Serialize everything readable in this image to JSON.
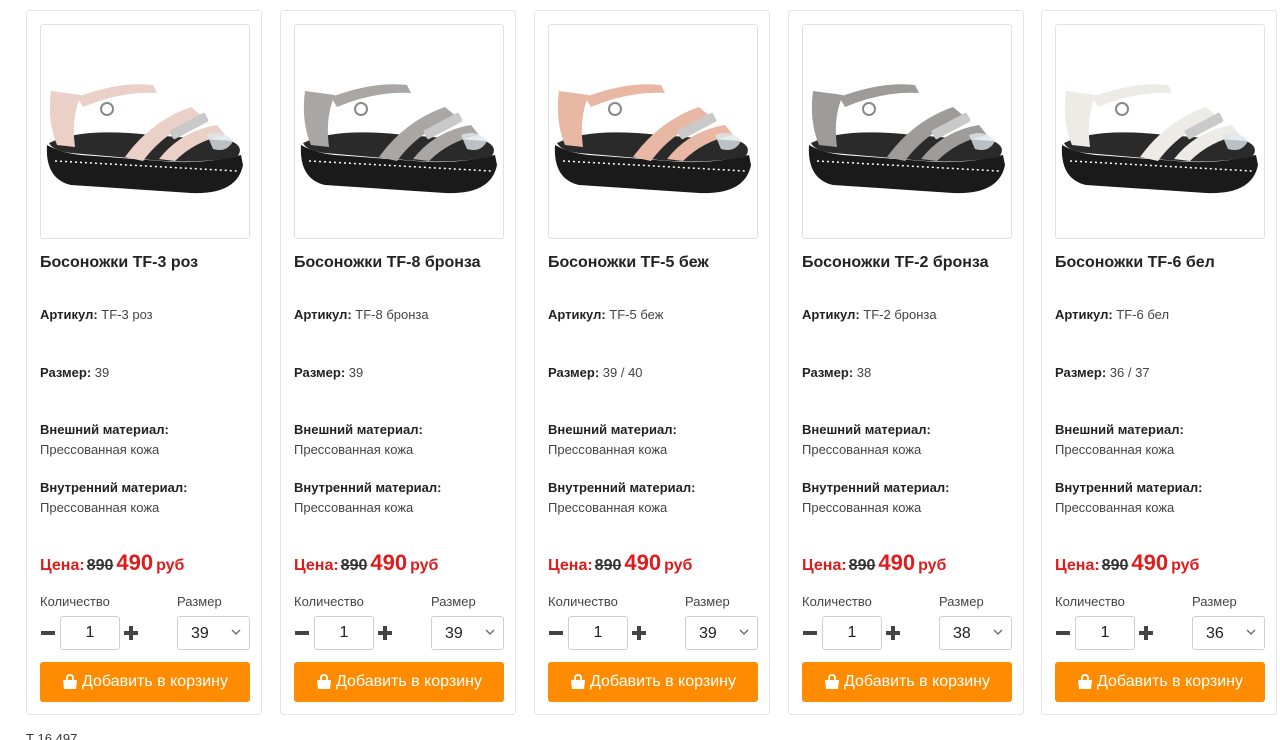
{
  "products": [
    {
      "title": "Босоножки TF-3 роз",
      "article_label": "Артикул:",
      "article": "TF-3 роз",
      "size_label": "Размер:",
      "size": "39",
      "outer_label": "Внешний материал:",
      "outer": "Прессованная кожа",
      "inner_label": "Внутренний материал:",
      "inner": "Прессованная кожа",
      "price_label": "Цена:",
      "old_price": "890",
      "new_price": "490",
      "currency": "руб",
      "qty_label": "Количество",
      "qty": "1",
      "size_select_label": "Размер",
      "size_selected": "39",
      "button": "Добавить в корзину",
      "strap_color": "#ead0c6"
    },
    {
      "title": "Босоножки TF-8 бронза",
      "article_label": "Артикул:",
      "article": "TF-8 бронза",
      "size_label": "Размер:",
      "size": "39",
      "outer_label": "Внешний материал:",
      "outer": "Прессованная кожа",
      "inner_label": "Внутренний материал:",
      "inner": "Прессованная кожа",
      "price_label": "Цена:",
      "old_price": "890",
      "new_price": "490",
      "currency": "руб",
      "qty_label": "Количество",
      "qty": "1",
      "size_select_label": "Размер",
      "size_selected": "39",
      "button": "Добавить в корзину",
      "strap_color": "#a9a6a3"
    },
    {
      "title": "Босоножки TF-5 беж",
      "article_label": "Артикул:",
      "article": "TF-5 беж",
      "size_label": "Размер:",
      "size": "39 / 40",
      "outer_label": "Внешний материал:",
      "outer": "Прессованная кожа",
      "inner_label": "Внутренний материал:",
      "inner": "Прессованная кожа",
      "price_label": "Цена:",
      "old_price": "890",
      "new_price": "490",
      "currency": "руб",
      "qty_label": "Количество",
      "qty": "1",
      "size_select_label": "Размер",
      "size_selected": "39",
      "button": "Добавить в корзину",
      "strap_color": "#e8b8a4"
    },
    {
      "title": "Босоножки TF-2 бронза",
      "article_label": "Артикул:",
      "article": "TF-2 бронза",
      "size_label": "Размер:",
      "size": "38",
      "outer_label": "Внешний материал:",
      "outer": "Прессованная кожа",
      "inner_label": "Внутренний материал:",
      "inner": "Прессованная кожа",
      "price_label": "Цена:",
      "old_price": "890",
      "new_price": "490",
      "currency": "руб",
      "qty_label": "Количество",
      "qty": "1",
      "size_select_label": "Размер",
      "size_selected": "38",
      "button": "Добавить в корзину",
      "strap_color": "#9e9c9a"
    },
    {
      "title": "Босоножки TF-6 бел",
      "article_label": "Артикул:",
      "article": "TF-6 бел",
      "size_label": "Размер:",
      "size": "36 / 37",
      "outer_label": "Внешний материал:",
      "outer": "Прессованная кожа",
      "inner_label": "Внутренний материал:",
      "inner": "Прессованная кожа",
      "price_label": "Цена:",
      "old_price": "890",
      "new_price": "490",
      "currency": "руб",
      "qty_label": "Количество",
      "qty": "1",
      "size_select_label": "Размер",
      "size_selected": "36",
      "button": "Добавить в корзину",
      "strap_color": "#ecebe6"
    }
  ],
  "footer": {
    "text": "Т        16      497"
  },
  "colors": {
    "accent": "#ff8c00",
    "price": "#e01b1b"
  }
}
